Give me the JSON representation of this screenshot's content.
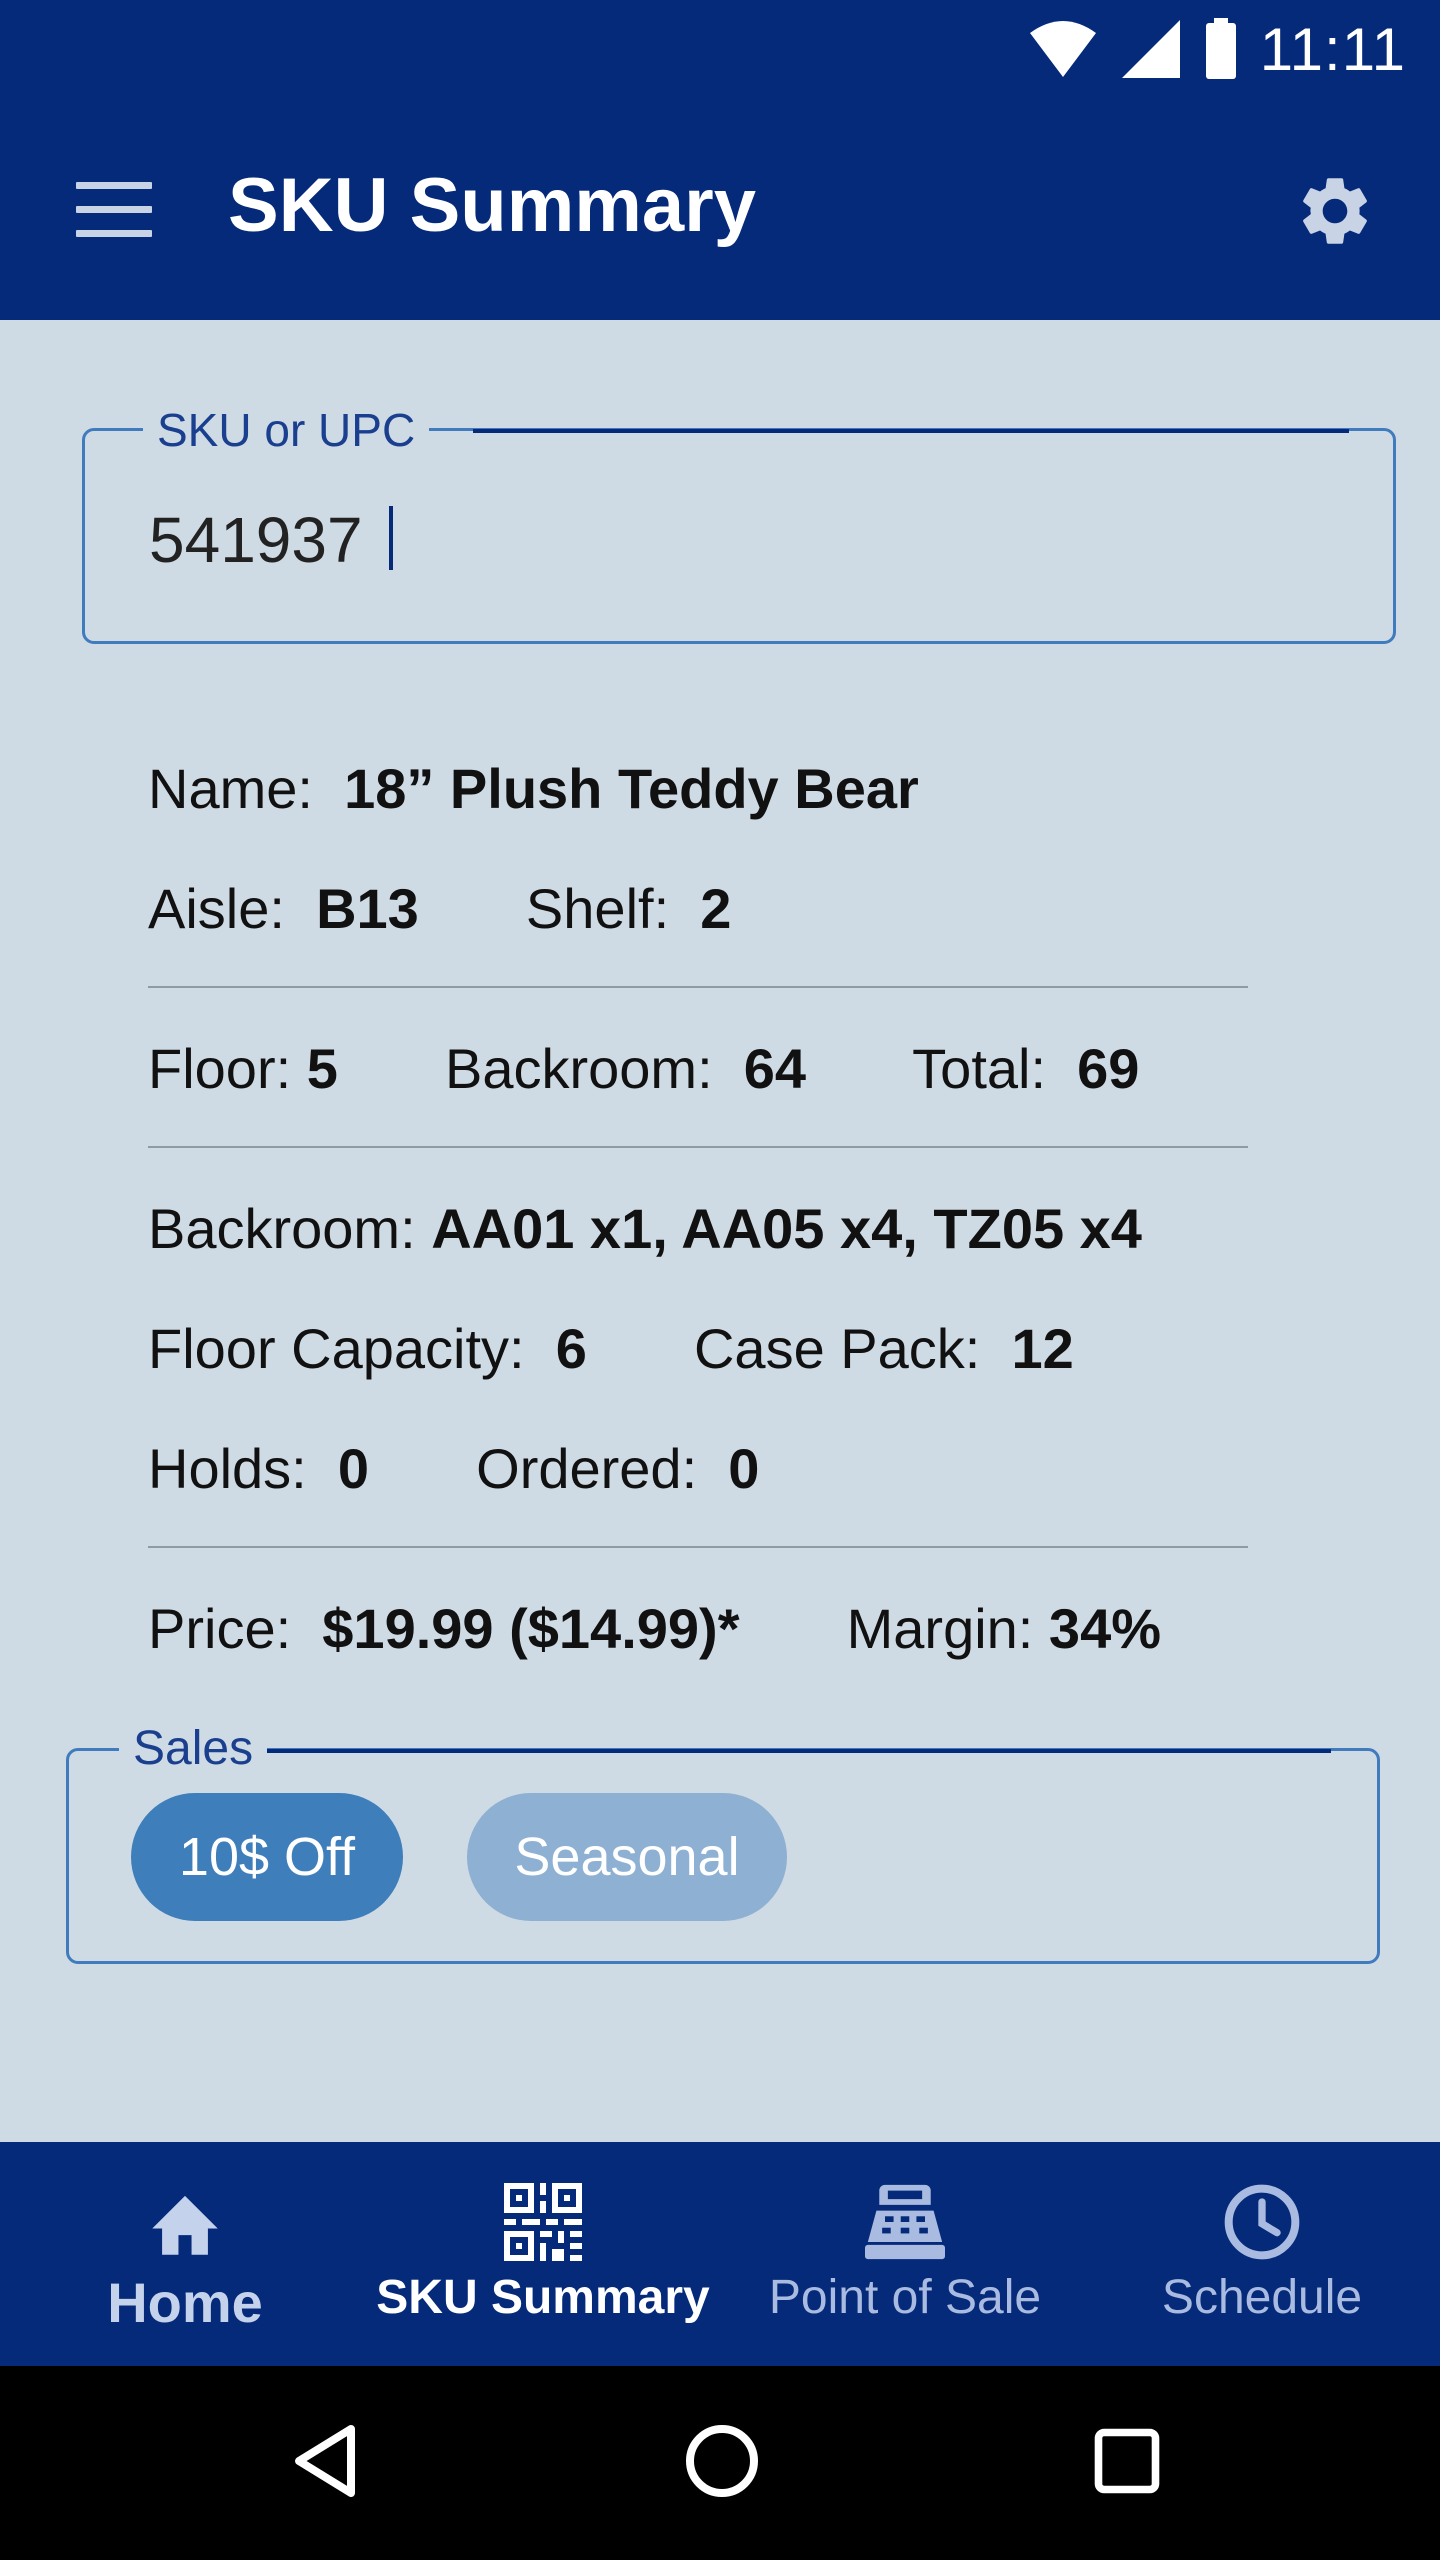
{
  "status_bar": {
    "time": "11:11"
  },
  "app_bar": {
    "title": "SKU Summary"
  },
  "sku_field": {
    "label": "SKU or UPC",
    "value": "541937"
  },
  "details": {
    "name_label": "Name:",
    "name_value": "18” Plush Teddy Bear",
    "aisle_label": "Aisle:",
    "aisle_value": "B13",
    "shelf_label": "Shelf:",
    "shelf_value": "2",
    "floor_label": "Floor:",
    "floor_value": "5",
    "backroom_label": "Backroom:",
    "backroom_value": "64",
    "total_label": "Total:",
    "total_value": "69",
    "backroom_locations_label": "Backroom:",
    "backroom_locations_value": "AA01 x1, AA05 x4, TZ05 x4",
    "floor_capacity_label": "Floor Capacity:",
    "floor_capacity_value": "6",
    "case_pack_label": "Case Pack:",
    "case_pack_value": "12",
    "holds_label": "Holds:",
    "holds_value": "0",
    "ordered_label": "Ordered:",
    "ordered_value": "0",
    "price_label": "Price:",
    "price_value": "$19.99 ($14.99)*",
    "margin_label": "Margin:",
    "margin_value": "34%"
  },
  "sales": {
    "label": "Sales",
    "chips": [
      {
        "label": "10$ Off"
      },
      {
        "label": "Seasonal"
      }
    ]
  },
  "bottom_nav": {
    "items": [
      {
        "label": "Home",
        "icon": "home-icon"
      },
      {
        "label": "SKU Summary",
        "icon": "qr-code-icon"
      },
      {
        "label": "Point of Sale",
        "icon": "cash-register-icon"
      },
      {
        "label": "Schedule",
        "icon": "clock-icon"
      }
    ],
    "active": "SKU Summary"
  },
  "colors": {
    "primary": "#052a7a",
    "background": "#cfdbe4",
    "chip_active": "#3e7ebb",
    "chip_inactive": "#8eb0d2"
  }
}
